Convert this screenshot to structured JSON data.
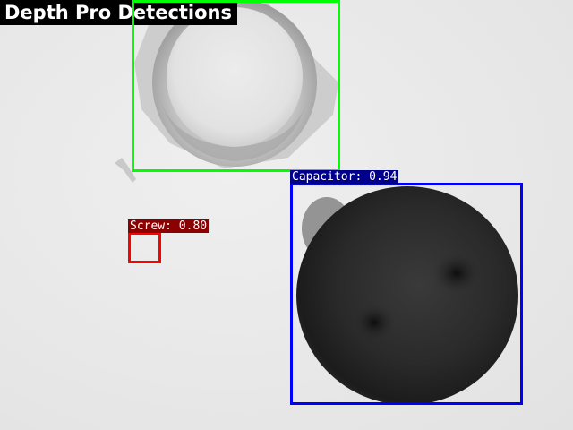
{
  "title": "Depth Pro Detections",
  "detections": [
    {
      "class": "Capacitor",
      "label": "Capacitor: 0.94",
      "score": 0.94,
      "color": "#0000ff",
      "label_bg": "#00008b"
    },
    {
      "class": "Screw",
      "label": "Screw: 0.80",
      "score": 0.8,
      "color": "#ff0000",
      "label_bg": "#8b0000"
    },
    {
      "class": "",
      "label": "",
      "color": "#00ff00"
    }
  ]
}
